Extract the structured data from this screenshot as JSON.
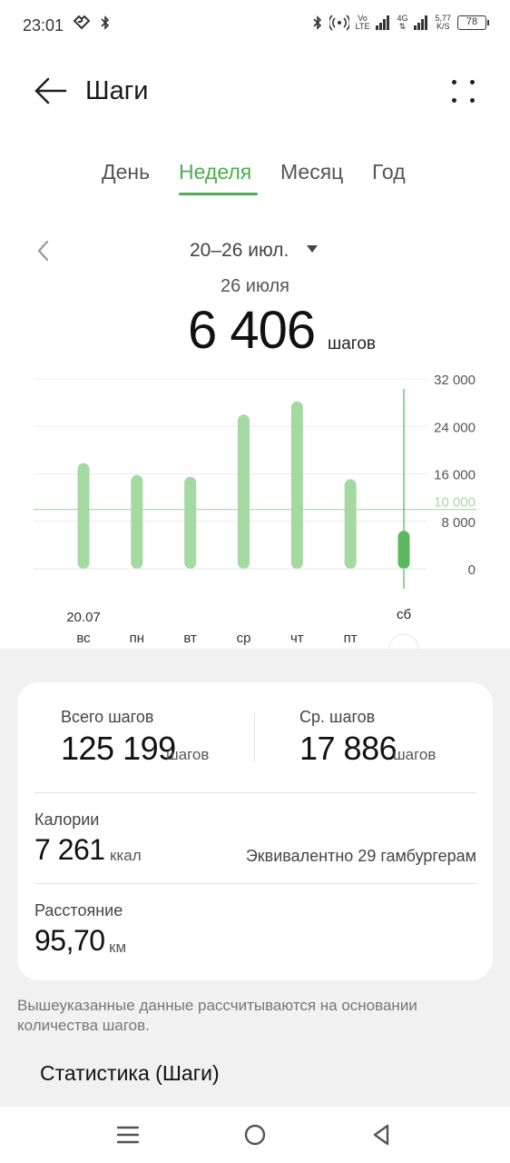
{
  "status_bar": {
    "time": "23:01",
    "net_speed_value": "5,77",
    "net_speed_unit": "K/S",
    "volte_top": "Vo",
    "volte_bottom": "LTE",
    "network_type": "4G",
    "battery_level": "78"
  },
  "header": {
    "title": "Шаги"
  },
  "tabs": [
    {
      "label": "День",
      "active": false
    },
    {
      "label": "Неделя",
      "active": true
    },
    {
      "label": "Месяц",
      "active": false
    },
    {
      "label": "Год",
      "active": false
    }
  ],
  "period": {
    "range_label": "20–26 июл.",
    "selected_date": "26 июля",
    "selected_steps": "6 406",
    "steps_unit": "шагов"
  },
  "chart_data": {
    "type": "bar",
    "categories": [
      "вс",
      "пн",
      "вт",
      "ср",
      "чт",
      "пт",
      "сб"
    ],
    "first_date_label": "20.07",
    "values": [
      17800,
      15800,
      15500,
      26000,
      28200,
      15100,
      6406
    ],
    "selected_index": 6,
    "ylim": [
      0,
      32000
    ],
    "y_ticks": [
      "32 000",
      "24 000",
      "16 000",
      "8 000",
      "0"
    ],
    "y_tick_values": [
      32000,
      24000,
      16000,
      8000,
      0
    ],
    "goal_value": 10000,
    "goal_label": "10 000",
    "bar_color": "#a5d9a2",
    "selected_bar_color": "#5cb85c",
    "goal_color": "#a5d9a2",
    "grid": true
  },
  "summary": {
    "total_label": "Всего шагов",
    "total_value": "125 199",
    "total_unit": "шагов",
    "avg_label": "Ср. шагов",
    "avg_value": "17 886",
    "avg_unit": "шагов",
    "calories_label": "Калории",
    "calories_value": "7 261",
    "calories_unit": "ккал",
    "equivalent_text": "Эквивалентно 29 гамбургерам",
    "distance_label": "Расстояние",
    "distance_value": "95,70",
    "distance_unit": "км"
  },
  "note": "Вышеуказанные данные рассчитываются на основании количества шагов.",
  "stats_section_title": "Статистика (Шаги)",
  "colors": {
    "accent": "#4caf50",
    "background_gray": "#f1f1f1"
  }
}
